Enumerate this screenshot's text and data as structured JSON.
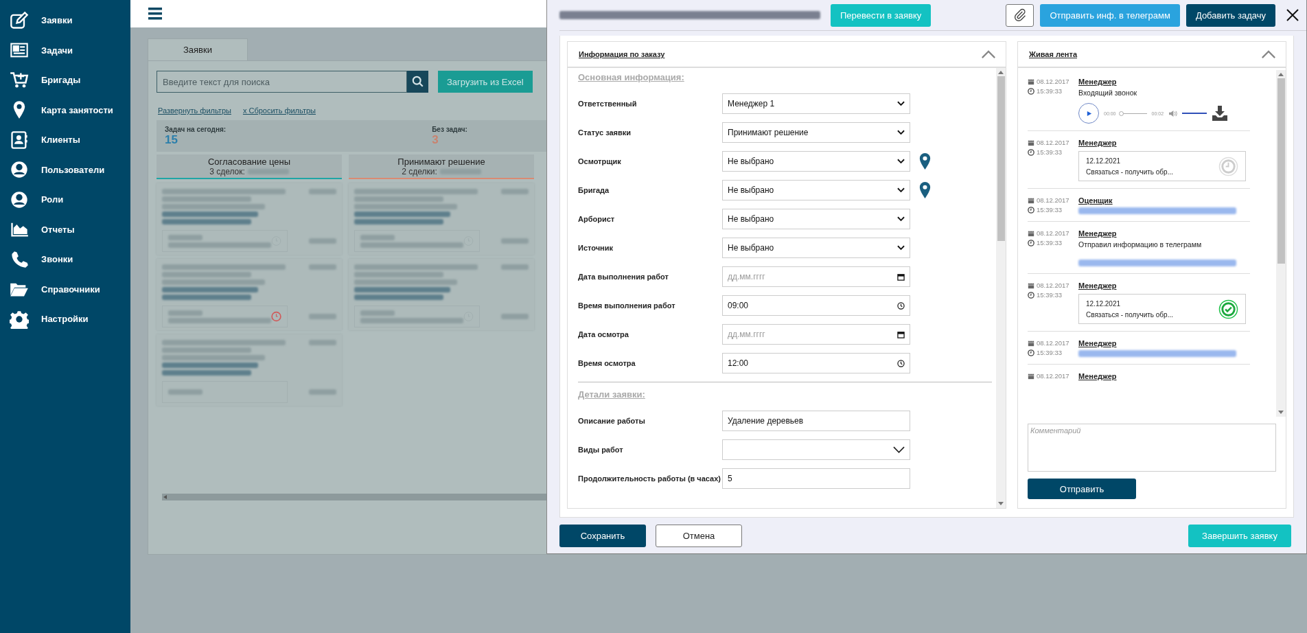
{
  "sidebar": {
    "items": [
      {
        "label": "Заявки"
      },
      {
        "label": "Задачи"
      },
      {
        "label": "Бригады"
      },
      {
        "label": "Карта занятости"
      },
      {
        "label": "Клиенты"
      },
      {
        "label": "Пользователи"
      },
      {
        "label": "Роли"
      },
      {
        "label": "Отчеты"
      },
      {
        "label": "Звонки"
      },
      {
        "label": "Справочники"
      },
      {
        "label": "Настройки"
      }
    ]
  },
  "main": {
    "tabs": [
      {
        "label": "Заявки",
        "selected": true
      }
    ],
    "search": {
      "placeholder": "Введите текст для поиска"
    },
    "excel_button": "Загрузить из Excel",
    "filter_links": [
      "Развернуть фильтры",
      "x Сбросить фильтры"
    ],
    "stats": [
      {
        "label": "Задач на сегодня:",
        "value": "15",
        "color": "#2b7fab"
      },
      {
        "label": "Без задач:",
        "value": "3",
        "color": "#c9836f"
      }
    ],
    "columns": [
      {
        "title": "Согласование цены",
        "count": "3 сделок:",
        "color": "#1ea5a5",
        "cards": [
          {
            "kind": "task",
            "overdue": false
          },
          {
            "kind": "task",
            "overdue": true
          },
          {
            "kind": "empty"
          }
        ]
      },
      {
        "title": "Принимают решение",
        "count": "2 сделки:",
        "color": "#d98a72",
        "cards": [
          {
            "kind": "task",
            "overdue": false
          },
          {
            "kind": "task",
            "overdue": false
          }
        ]
      }
    ]
  },
  "modal": {
    "convert_button": "Перевести в заявку",
    "telegram_button": "Отправить инф. в телеграмм",
    "add_task_button": "Добавить задачу",
    "order_info": {
      "title": "Информация по заказу",
      "sections": [
        {
          "title": "Основная информация:",
          "fields": [
            {
              "label": "Ответственный",
              "kind": "select",
              "value": "Менеджер 1",
              "map_pin": false
            },
            {
              "label": "Статус заявки",
              "kind": "select",
              "value": "Принимают решение",
              "map_pin": false
            },
            {
              "label": "Осмотрщик",
              "kind": "select",
              "value": "Не выбрано",
              "map_pin": true
            },
            {
              "label": "Бригада",
              "kind": "select",
              "value": "Не выбрано",
              "map_pin": true
            },
            {
              "label": "Арборист",
              "kind": "select",
              "value": "Не выбрано",
              "map_pin": false
            },
            {
              "label": "Источник",
              "kind": "select",
              "value": "Не выбрано",
              "map_pin": false
            },
            {
              "label": "Дата выполнения работ",
              "kind": "date",
              "placeholder": "дд.мм.гггг",
              "map_pin": false
            },
            {
              "label": "Время выполнения работ",
              "kind": "time",
              "value": "09:00",
              "map_pin": false
            },
            {
              "label": "Дата осмотра",
              "kind": "date",
              "placeholder": "дд.мм.гггг",
              "map_pin": false
            },
            {
              "label": "Время осмотра",
              "kind": "time",
              "value": "12:00",
              "map_pin": false
            }
          ]
        },
        {
          "title": "Детали заявки:",
          "fields": [
            {
              "label": "Описание работы",
              "kind": "text",
              "value": "Удаление деревьев",
              "map_pin": false
            },
            {
              "label": "Виды работ",
              "kind": "multiselect",
              "map_pin": false
            },
            {
              "label": "Продолжительность работы (в часах)",
              "kind": "text",
              "value": "5",
              "map_pin": false
            }
          ]
        }
      ]
    },
    "feed": {
      "title": "Живая лента",
      "items": [
        {
          "kind": "call",
          "date": "08.12.2017",
          "time": "15:39:33",
          "author": "Менеджер",
          "text": "Входящий звонок",
          "player": {
            "start": "00:00",
            "end": "00:02",
            "level": 0,
            "volume": {
              "level": 1
            }
          }
        },
        {
          "kind": "task",
          "date": "08.12.2017",
          "time": "15:39:33",
          "author": "Менеджер",
          "task": {
            "date": "12.12.2021",
            "text": "Связаться - получить обр...",
            "done": false
          }
        },
        {
          "kind": "hidden",
          "date": "08.12.2017",
          "time": "15:39:33",
          "author": "Оценщик"
        },
        {
          "kind": "message",
          "date": "08.12.2017",
          "time": "15:39:33",
          "author": "Менеджер",
          "text": "Отправил информацию в телеграмм"
        },
        {
          "kind": "task",
          "date": "08.12.2017",
          "time": "15:39:33",
          "author": "Менеджер",
          "task": {
            "date": "12.12.2021",
            "text": "Связаться - получить обр...",
            "done": true
          }
        },
        {
          "kind": "hidden",
          "date": "08.12.2017",
          "time": "15:39:33",
          "author": "Менеджер"
        },
        {
          "kind": "hidden",
          "date": "08.12.2017",
          "author": "Менеджер"
        }
      ]
    },
    "comment": {
      "placeholder": "Комментарий"
    },
    "send_button": "Отправить",
    "save_button": "Сохранить",
    "cancel_button": "Отмена",
    "finish_button": "Завершить заявку"
  }
}
